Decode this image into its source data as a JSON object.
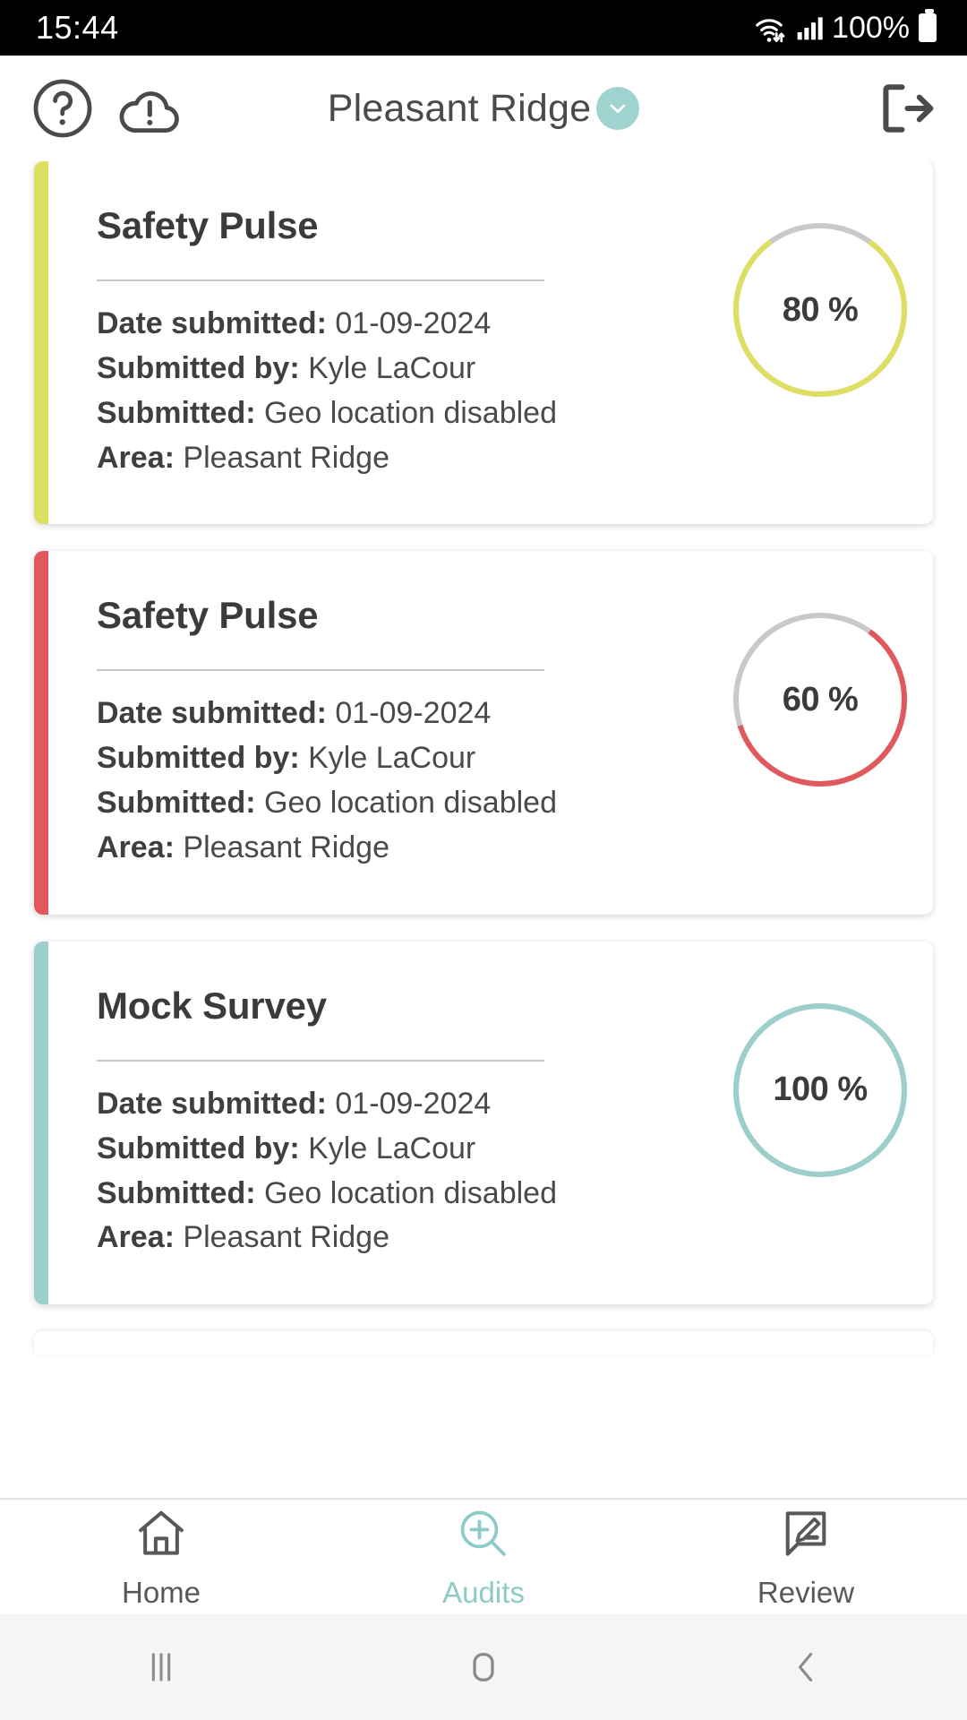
{
  "status_bar": {
    "time": "15:44",
    "battery_percent": "100%",
    "icons": [
      "wifi-icon",
      "cellular-signal-icon",
      "battery-icon"
    ]
  },
  "header": {
    "help_icon": "help-circle-icon",
    "cloud_alert_icon": "cloud-alert-icon",
    "title": "Pleasant Ridge",
    "dropdown_icon": "chevron-down-icon",
    "logout_icon": "logout-icon",
    "accent_color": "#9ed3d0"
  },
  "labels": {
    "date_submitted": "Date submitted:",
    "submitted_by": "Submitted by:",
    "submitted": "Submitted:",
    "area": "Area:"
  },
  "cards": [
    {
      "title": "Safety Pulse",
      "date_submitted": "01-09-2024",
      "submitted_by": "Kyle LaCour",
      "submitted": "Geo location disabled",
      "area": "Pleasant Ridge",
      "percent_label": "80 %",
      "percent_value": 80,
      "accent_color": "#dede63",
      "track_color": "#c9c9c9"
    },
    {
      "title": "Safety Pulse",
      "date_submitted": "01-09-2024",
      "submitted_by": "Kyle LaCour",
      "submitted": "Geo location disabled",
      "area": "Pleasant Ridge",
      "percent_label": "60 %",
      "percent_value": 60,
      "accent_color": "#e0595c",
      "track_color": "#c9c9c9"
    },
    {
      "title": "Mock Survey",
      "date_submitted": "01-09-2024",
      "submitted_by": "Kyle LaCour",
      "submitted": "Geo location disabled",
      "area": "Pleasant Ridge",
      "percent_label": "100 %",
      "percent_value": 100,
      "accent_color": "#9ccfcb",
      "track_color": "#c9c9c9"
    }
  ],
  "tabbar": {
    "active": "Audits",
    "active_color": "#8ccbc7",
    "inactive_color": "#585858",
    "items": [
      {
        "label": "Home",
        "icon": "home-icon"
      },
      {
        "label": "Audits",
        "icon": "search-plus-icon"
      },
      {
        "label": "Review",
        "icon": "comment-edit-icon"
      }
    ]
  },
  "system_nav": {
    "recents_icon": "recent-apps-icon",
    "home_icon": "home-square-icon",
    "back_icon": "back-chevron-icon"
  }
}
